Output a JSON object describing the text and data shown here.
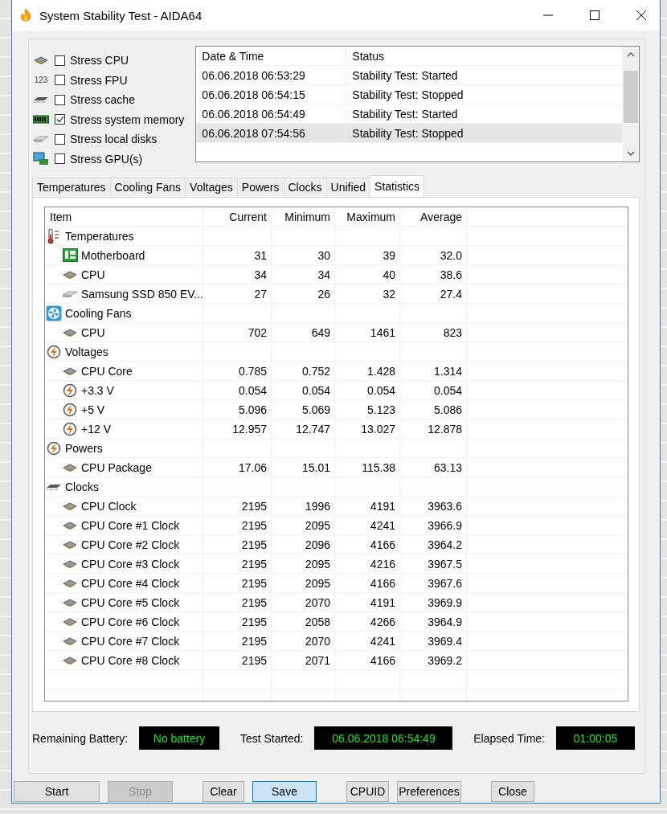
{
  "window": {
    "title": "System Stability Test - AIDA64"
  },
  "stress_options": [
    {
      "label": "Stress CPU",
      "checked": false
    },
    {
      "label": "Stress FPU",
      "checked": false,
      "icon_text": "123"
    },
    {
      "label": "Stress cache",
      "checked": false
    },
    {
      "label": "Stress system memory",
      "checked": true
    },
    {
      "label": "Stress local disks",
      "checked": false
    },
    {
      "label": "Stress GPU(s)",
      "checked": false
    }
  ],
  "log": {
    "columns": [
      "Date & Time",
      "Status"
    ],
    "rows": [
      {
        "date_time": "06.06.2018 06:53:29",
        "status": "Stability Test: Started",
        "selected": false
      },
      {
        "date_time": "06.06.2018 06:54:15",
        "status": "Stability Test: Stopped",
        "selected": false
      },
      {
        "date_time": "06.06.2018 06:54:49",
        "status": "Stability Test: Started",
        "selected": false
      },
      {
        "date_time": "06.06.2018 07:54:56",
        "status": "Stability Test: Stopped",
        "selected": true
      }
    ]
  },
  "tabs": [
    {
      "label": "Temperatures",
      "selected": false
    },
    {
      "label": "Cooling Fans",
      "selected": false
    },
    {
      "label": "Voltages",
      "selected": false
    },
    {
      "label": "Powers",
      "selected": false
    },
    {
      "label": "Clocks",
      "selected": false
    },
    {
      "label": "Unified",
      "selected": false
    },
    {
      "label": "Statistics",
      "selected": true
    }
  ],
  "statistics": {
    "columns": [
      "Item",
      "Current",
      "Minimum",
      "Maximum",
      "Average"
    ],
    "groups": [
      {
        "label": "Temperatures",
        "children": [
          {
            "label": "Motherboard",
            "values": [
              "31",
              "30",
              "39",
              "32.0"
            ]
          },
          {
            "label": "CPU",
            "values": [
              "34",
              "34",
              "40",
              "38.6"
            ]
          },
          {
            "label": "Samsung SSD 850 EV...",
            "values": [
              "27",
              "26",
              "32",
              "27.4"
            ]
          }
        ]
      },
      {
        "label": "Cooling Fans",
        "children": [
          {
            "label": "CPU",
            "values": [
              "702",
              "649",
              "1461",
              "823"
            ]
          }
        ]
      },
      {
        "label": "Voltages",
        "children": [
          {
            "label": "CPU Core",
            "values": [
              "0.785",
              "0.752",
              "1.428",
              "1.314"
            ]
          },
          {
            "label": "+3.3 V",
            "values": [
              "0.054",
              "0.054",
              "0.054",
              "0.054"
            ]
          },
          {
            "label": "+5 V",
            "values": [
              "5.096",
              "5.069",
              "5.123",
              "5.086"
            ]
          },
          {
            "label": "+12 V",
            "values": [
              "12.957",
              "12.747",
              "13.027",
              "12.878"
            ]
          }
        ]
      },
      {
        "label": "Powers",
        "children": [
          {
            "label": "CPU Package",
            "values": [
              "17.06",
              "15.01",
              "115.38",
              "63.13"
            ]
          }
        ]
      },
      {
        "label": "Clocks",
        "children": [
          {
            "label": "CPU Clock",
            "values": [
              "2195",
              "1996",
              "4191",
              "3963.6"
            ]
          },
          {
            "label": "CPU Core #1 Clock",
            "values": [
              "2195",
              "2095",
              "4241",
              "3966.9"
            ]
          },
          {
            "label": "CPU Core #2 Clock",
            "values": [
              "2195",
              "2096",
              "4166",
              "3964.2"
            ]
          },
          {
            "label": "CPU Core #3 Clock",
            "values": [
              "2195",
              "2095",
              "4216",
              "3967.5"
            ]
          },
          {
            "label": "CPU Core #4 Clock",
            "values": [
              "2195",
              "2095",
              "4166",
              "3967.6"
            ]
          },
          {
            "label": "CPU Core #5 Clock",
            "values": [
              "2195",
              "2070",
              "4191",
              "3969.9"
            ]
          },
          {
            "label": "CPU Core #6 Clock",
            "values": [
              "2195",
              "2058",
              "4266",
              "3964.9"
            ]
          },
          {
            "label": "CPU Core #7 Clock",
            "values": [
              "2195",
              "2070",
              "4241",
              "3969.4"
            ]
          },
          {
            "label": "CPU Core #8 Clock",
            "values": [
              "2195",
              "2071",
              "4166",
              "3969.2"
            ]
          }
        ]
      }
    ]
  },
  "status": [
    {
      "label": "Remaining Battery:",
      "value": "No battery"
    },
    {
      "label": "Test Started:",
      "value": "06.06.2018 06:54:49"
    },
    {
      "label": "Elapsed Time:",
      "value": "01:00:05"
    }
  ],
  "buttons": [
    {
      "label": "Start",
      "disabled": false,
      "focused": false
    },
    {
      "label": "Stop",
      "disabled": true,
      "focused": false
    },
    {
      "label": "Clear",
      "disabled": false,
      "focused": false
    },
    {
      "label": "Save",
      "disabled": false,
      "focused": true
    },
    {
      "label": "CPUID",
      "disabled": false,
      "focused": false
    },
    {
      "label": "Preferences",
      "disabled": false,
      "focused": false
    },
    {
      "label": "Close",
      "disabled": false,
      "focused": false
    }
  ]
}
